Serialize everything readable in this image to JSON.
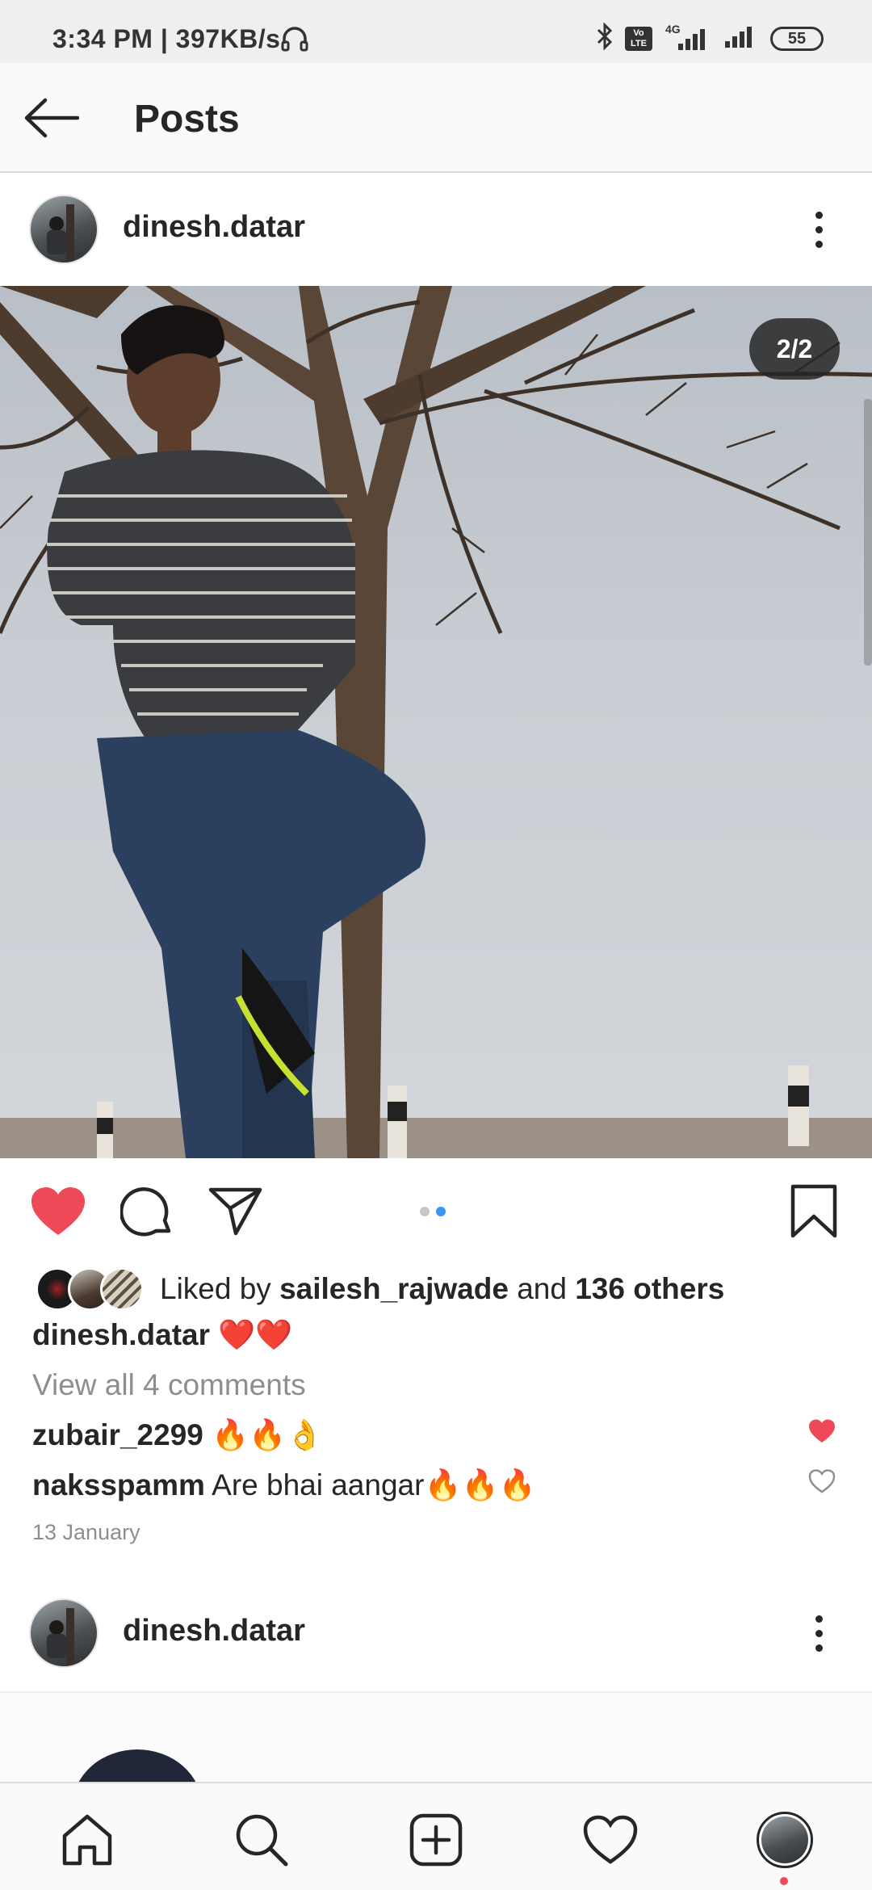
{
  "status_bar": {
    "time": "3:34 PM | 397KB/s",
    "network": "4G",
    "volte": "Vo LTE",
    "battery": "55",
    "icons": [
      "headphones-icon",
      "bluetooth-icon",
      "signal-icon",
      "battery-icon"
    ]
  },
  "header": {
    "title": "Posts",
    "back_icon": "arrow-left-icon"
  },
  "post": {
    "username": "dinesh.datar",
    "image_counter": "2/2",
    "carousel": {
      "total": 2,
      "active": 2
    },
    "liked": true,
    "likes": {
      "prefix": "Liked by",
      "user": "sailesh_rajwade",
      "joiner": "and",
      "others": "136 others"
    },
    "caption": {
      "user": "dinesh.datar",
      "text": "❤️❤️"
    },
    "view_comments": "View all 4 comments",
    "comments": [
      {
        "user": "zubair_2299",
        "text": "🔥🔥👌",
        "liked": true
      },
      {
        "user": "naksspamm",
        "text": "Are bhai aangar🔥🔥🔥",
        "liked": false
      }
    ],
    "date": "13 January"
  },
  "next_post": {
    "username": "dinesh.datar"
  },
  "colors": {
    "like_red": "#ed4956",
    "carousel_active": "#3897f0",
    "text_primary": "#262626",
    "text_secondary": "#8e8e8e"
  },
  "bottom_nav": [
    "home-icon",
    "search-icon",
    "new-post-icon",
    "activity-icon",
    "profile-avatar"
  ]
}
